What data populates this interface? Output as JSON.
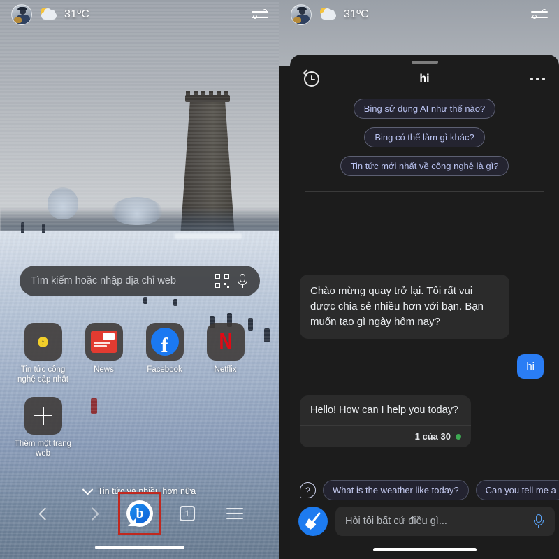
{
  "status": {
    "temperature": "31ºC",
    "avatar_name": "user-avatar",
    "weather_icon": "sun-cloud-icon",
    "tune_icon": "settings-sliders-icon"
  },
  "browser": {
    "search": {
      "placeholder": "Tìm kiếm hoặc nhập địa chỉ web",
      "qr_icon": "qr-code-icon",
      "mic_icon": "microphone-icon"
    },
    "shortcuts": [
      {
        "label": "Tin tức công nghệ cập nhật",
        "icon": "tech-news-icon"
      },
      {
        "label": "News",
        "icon": "news-icon"
      },
      {
        "label": "Facebook",
        "icon": "facebook-icon"
      },
      {
        "label": "Netflix",
        "icon": "netflix-icon"
      },
      {
        "label": "Thêm một trang web",
        "icon": "plus-icon"
      }
    ],
    "more_news_label": "Tin tức và nhiều hơn nữa",
    "nav": {
      "back_icon": "chevron-left-icon",
      "forward_icon": "chevron-right-icon",
      "bing_label": "b",
      "tab_count": "1",
      "menu_icon": "hamburger-menu-icon"
    }
  },
  "chat": {
    "title": "hi",
    "history_icon": "history-clock-icon",
    "more_icon": "more-options-icon",
    "top_suggestions": [
      "Bing sử dụng AI như thế nào?",
      "Bing có thể làm gì khác?",
      "Tin tức mới nhất về công nghệ là gì?"
    ],
    "messages": [
      {
        "role": "bot",
        "text": "Chào mừng quay trở lại. Tôi rất vui được chia sẻ nhiều hơn với bạn. Bạn muốn tạo gì ngày hôm nay?"
      },
      {
        "role": "user",
        "text": "hi"
      },
      {
        "role": "bot",
        "text": "Hello! How can I help you today?",
        "counter": "1 của 30"
      }
    ],
    "bottom_suggestions": [
      "What is the weather like today?",
      "Can you tell me a"
    ],
    "question_icon": "question-bubble-icon",
    "input": {
      "placeholder": "Hỏi tôi bất cứ điều gì...",
      "sweep_icon": "broom-new-topic-icon",
      "mic_icon": "microphone-icon"
    }
  },
  "colors": {
    "accent_blue": "#2a7df5",
    "highlight_red": "#c0281f",
    "chip_text": "#b9c2f0",
    "status_green": "#3da952"
  }
}
